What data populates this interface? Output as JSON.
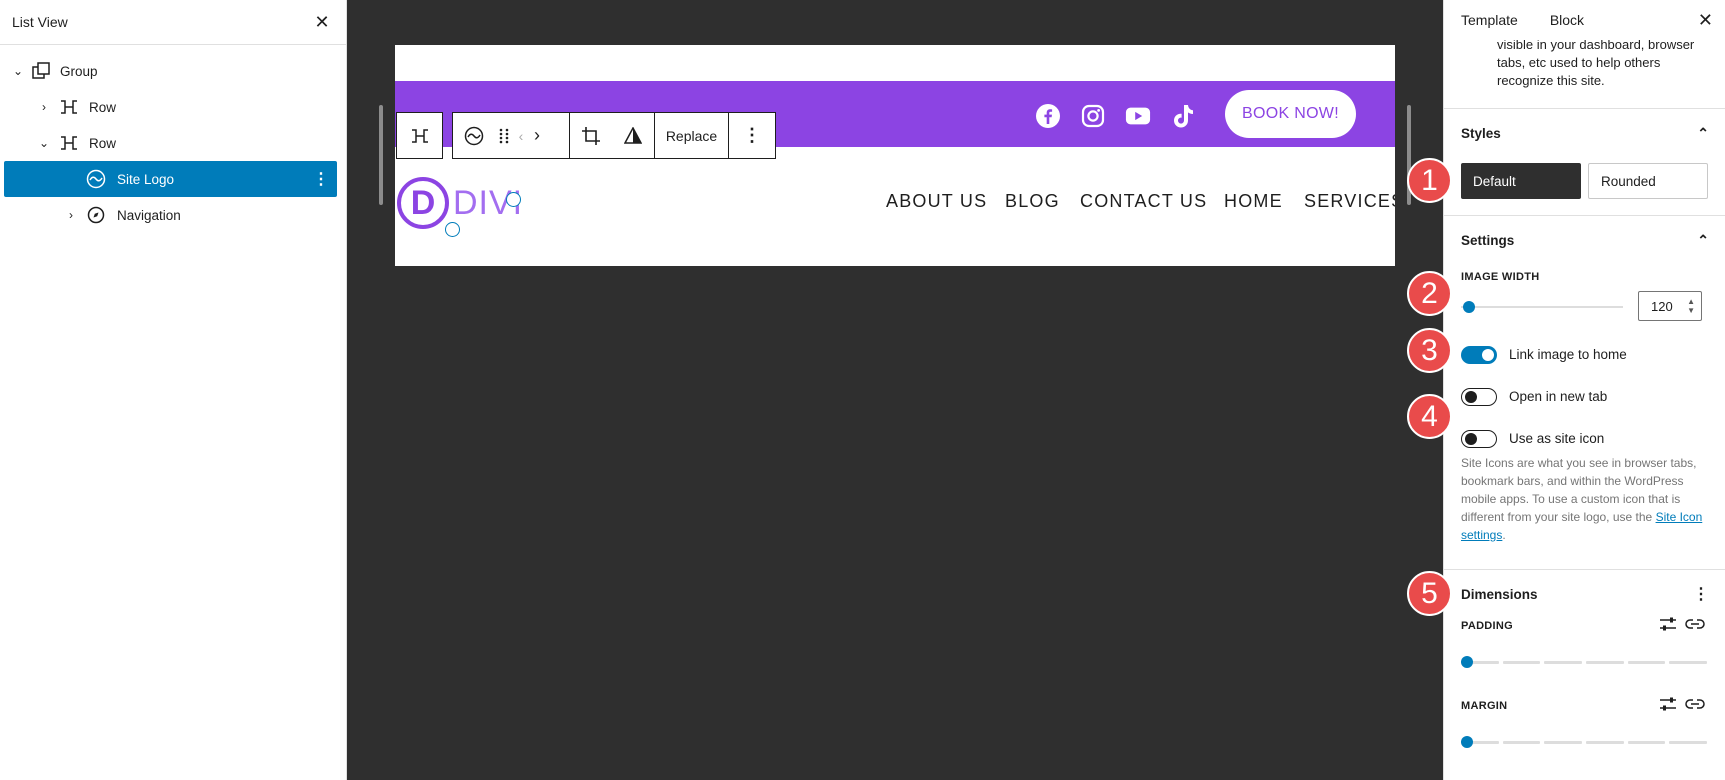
{
  "listview": {
    "title": "List View",
    "close_label": "✕",
    "items": [
      {
        "label": "Group"
      },
      {
        "label": "Row"
      },
      {
        "label": "Row"
      },
      {
        "label": "Site Logo"
      },
      {
        "label": "Navigation"
      }
    ]
  },
  "site": {
    "book_button": "BOOK NOW!",
    "logo_letter": "D",
    "logo_text": "DIVI",
    "nav": [
      "ABOUT US",
      "BLOG",
      "CONTACT US",
      "HOME",
      "SERVICES"
    ],
    "brand_color": "#8c44e3",
    "social_icons": [
      "facebook-icon",
      "instagram-icon",
      "youtube-icon",
      "tiktok-icon"
    ]
  },
  "toolbar": {
    "replace_label": "Replace"
  },
  "sidebar": {
    "tabs": [
      "Template",
      "Block"
    ],
    "close_label": "✕",
    "site_desc": "visible in your dashboard, browser tabs, etc used to help others recognize this site.",
    "styles": {
      "title": "Styles",
      "options": [
        "Default",
        "Rounded"
      ],
      "selected": "Default"
    },
    "settings": {
      "title": "Settings",
      "image_width_label": "IMAGE WIDTH",
      "image_width_value": "120",
      "toggles": [
        {
          "label": "Link image to home",
          "on": true
        },
        {
          "label": "Open in new tab",
          "on": false
        },
        {
          "label": "Use as site icon",
          "on": false
        }
      ],
      "help_text": "Site Icons are what you see in browser tabs, bookmark bars, and within the WordPress mobile apps. To use a custom icon that is different from your site logo, use the ",
      "help_link": "Site Icon settings",
      "help_end": "."
    },
    "dimensions": {
      "title": "Dimensions",
      "padding_label": "PADDING",
      "margin_label": "MARGIN"
    }
  },
  "badges": [
    "1",
    "2",
    "3",
    "4",
    "5"
  ],
  "accent_color": "#007cba",
  "badge_color": "#e94b4b"
}
